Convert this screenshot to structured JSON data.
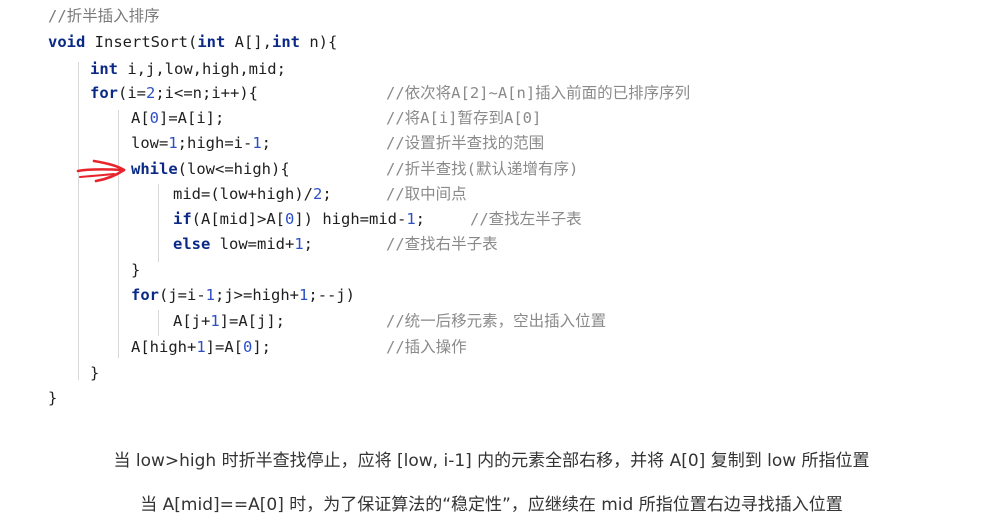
{
  "code": {
    "title_comment": "//折半插入排序",
    "lines": [
      {
        "code": "void InsertSort(int A[],int n){",
        "comment": ""
      },
      {
        "code": "int i,j,low,high,mid;",
        "comment": ""
      },
      {
        "code": "for(i=2;i<=n;i++){",
        "comment": "//依次将A[2]~A[n]插入前面的已排序序列"
      },
      {
        "code": "A[0]=A[i];",
        "comment": "//将A[i]暂存到A[0]"
      },
      {
        "code": "low=1;high=i-1;",
        "comment": "//设置折半查找的范围"
      },
      {
        "code": "while(low<=high){",
        "comment": "//折半查找(默认递增有序)"
      },
      {
        "code": "mid=(low+high)/2;",
        "comment": "//取中间点"
      },
      {
        "code": "if(A[mid]>A[0]) high=mid-1;",
        "comment": "//查找左半子表"
      },
      {
        "code": "else low=mid+1;",
        "comment": "//查找右半子表"
      },
      {
        "code": "}",
        "comment": ""
      },
      {
        "code": "for(j=i-1;j>=high+1;--j)",
        "comment": ""
      },
      {
        "code": "A[j+1]=A[j];",
        "comment": "//统一后移元素，空出插入位置"
      },
      {
        "code": "A[high+1]=A[0];",
        "comment": "//插入操作"
      },
      {
        "code": "}",
        "comment": ""
      },
      {
        "code": "}",
        "comment": ""
      }
    ]
  },
  "notes": {
    "line1": "当 low>high 时折半查找停止，应将 [low, i-1] 内的元素全部右移，并将 A[0] 复制到 low 所指位置",
    "line2": "当 A[mid]==A[0] 时，为了保证算法的“稳定性”，应继续在 mid 所指位置右边寻找插入位置"
  },
  "colors": {
    "keyword": "#0b2a86",
    "number": "#2d4fc4",
    "comment": "#8a8a8a",
    "annotation_arrow": "#e8232b"
  },
  "icons": {
    "annotation": "handdrawn-arrow-icon"
  }
}
